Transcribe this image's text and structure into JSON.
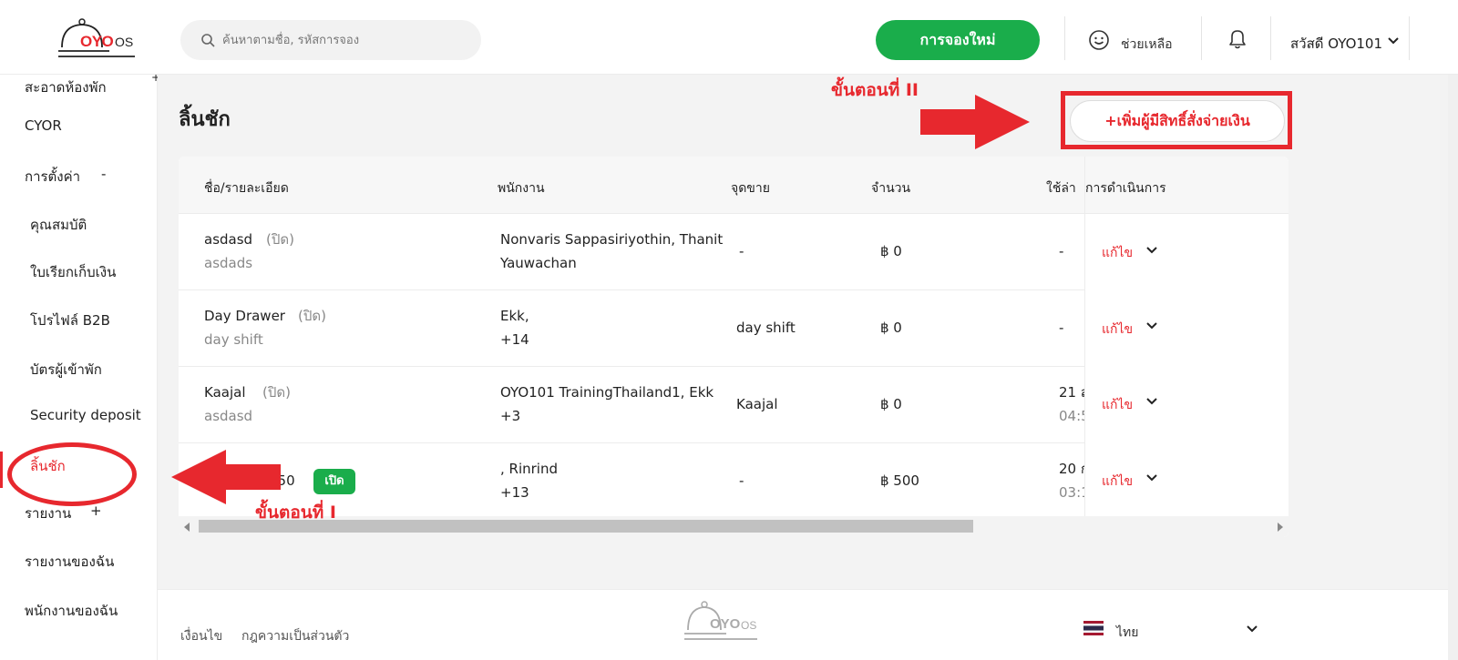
{
  "header": {
    "logo_text": "OYO",
    "logo_os": "OS",
    "search_placeholder": "ค้นหาตามชื่อ, รหัสการจอง",
    "new_booking": "การจองใหม่",
    "help": "ช่วยเหลือ",
    "user": "สวัสดี OYO101"
  },
  "sidebar": {
    "items": [
      {
        "label": "สะอาดห้องพัก",
        "suffix": "+"
      },
      {
        "label": "CYOR"
      },
      {
        "label": "การตั้งค่า",
        "suffix": "-"
      },
      {
        "label": "คุณสมบัติ"
      },
      {
        "label": "ใบเรียกเก็บเงิน"
      },
      {
        "label": "โปรไฟล์ B2B"
      },
      {
        "label": "บัตรผู้เข้าพัก"
      },
      {
        "label": "Security deposit"
      },
      {
        "label": "ลิ้นชัก"
      },
      {
        "label": "รายงาน",
        "suffix": "+"
      },
      {
        "label": "รายงานของฉัน"
      },
      {
        "label": "พนักงานของฉัน"
      }
    ]
  },
  "main": {
    "title": "ลิ้นชัก",
    "add_button": "+เพิ่มผู้มีสิทธิ์สั่งจ่ายเงิน",
    "table": {
      "headers": [
        "ชื่อ/รายละเอียด",
        "พนักงาน",
        "จุดขาย",
        "จำนวน",
        "ใช้ล่า",
        "การดำเนินการ"
      ],
      "rows": [
        {
          "name": "asdasd",
          "status": "(ปิด)",
          "detail": "asdads",
          "staff1": "Nonvaris Sappasiriyothin, Thanit",
          "staff2": "Yauwachan",
          "pos": "-",
          "amount": "฿ 0",
          "last1": "-",
          "last2": "",
          "action": "แก้ไข"
        },
        {
          "name": "Day Drawer",
          "status": "(ปิด)",
          "detail": "day shift",
          "staff1": "Ekk,",
          "staff2": "+14",
          "pos": "day shift",
          "amount": "฿ 0",
          "last1": "-",
          "last2": "",
          "action": "แก้ไข"
        },
        {
          "name": "Kaajal",
          "status": "(ปิด)",
          "detail": "asdasd",
          "staff1": "OYO101 TrainingThailand1, Ekk",
          "staff2": "+3",
          "pos": "Kaajal",
          "amount": "฿ 0",
          "last1": "21 ส",
          "last2": "04:5",
          "action": "แก้ไข"
        },
        {
          "name": "550",
          "status": "เปิด",
          "detail": "",
          "staff1": ", Rinrind",
          "staff2": "+13",
          "pos": "-",
          "amount": "฿ 500",
          "last1": "20 ก",
          "last2": "03:1",
          "action": "แก้ไข"
        }
      ]
    }
  },
  "footer": {
    "terms": "เงื่อนไข",
    "privacy": "กฎความเป็นส่วนตัว",
    "language": "ไทย"
  },
  "annotations": {
    "step1": "ขั้นตอนที่ I",
    "step2": "ขั้นตอนที่ II",
    "color": "#e7282e"
  },
  "colors": {
    "brand_red": "#e7282e",
    "green": "#1aad4b"
  }
}
